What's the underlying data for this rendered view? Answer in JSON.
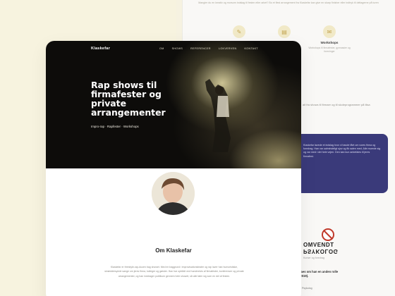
{
  "background": {
    "intro": "Mangler du en kreativ og morsom indslag til festen eller arket? Bo et flest arrangement fra Klaskefar kan give en skarp finisher eller indtryk til deltagerne på turen",
    "features": [
      {
        "icon": "mic-icon",
        "title": "",
        "desc": ""
      },
      {
        "icon": "document-icon",
        "title": "",
        "desc": ""
      },
      {
        "icon": "chat-icon",
        "title": "Workshops",
        "desc": "Workshops til firmafester, gymnasier og foreninger"
      }
    ],
    "side_text": "alt fra shows til firmaer og til skoleprogrammer på tilsa",
    "purple_text": "Klaskefar lavede et indslag hvor vi havde fået om vores firma og foredrag. Han var ualmindeligt sjov og fik salen med. Alle morede sig og var med i det hele vejen. Den kan kun anbefales til jeres firmafest.",
    "badge": {
      "word1": "OMVENDT",
      "word2": "PSYKOLOG",
      "small": "Kurser og foredrag",
      "foot": "Laes om han en anden rolle (2019).",
      "foot2": "af Psykolog"
    }
  },
  "site": {
    "logo": "Klaskefar",
    "nav": [
      "OM",
      "SHOWS",
      "REFERENCER",
      "LOKVERVEN",
      "KONTAKT"
    ],
    "hero_title": "Rap shows til firmafester og private arrangementer",
    "hero_sub": "Impro-rap · Rapfester · Workshops",
    "about_title": "Om Klaskefar",
    "about_text": "Klaskefar er freestyle-rap-duoen bag showet. Med en baggrund i improvisationsteater og rap laver han humoristiske, skræddersyede sange om jeres firma, kolleger og gæster. Han har optrådt ved hundredvis af firmafester, konferencer og private arrangementer, og han inddrager publikum gennem hele showet, så alle føler sig som en del af festen.",
    "accent_color": "#c3a552"
  }
}
